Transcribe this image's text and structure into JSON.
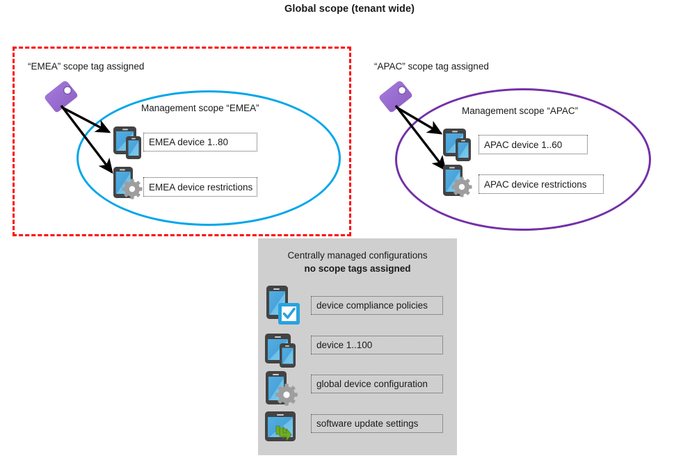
{
  "diagram": {
    "title": "Global scope (tenant wide)",
    "colors": {
      "scope_box_border": "#fe0000",
      "emea_ellipse": "#00a6eb",
      "apac_ellipse": "#7430a8",
      "tag_icon": "#9b6fd4",
      "panel_background": "#cfcfcf",
      "device_screen": "#4aa3db",
      "device_body": "#434343",
      "gear": "#9e9e9e",
      "check_badge": "#29a3dd",
      "sync_arrow": "#6fae24"
    }
  },
  "emea": {
    "scope_tag_label": "“EMEA” scope tag assigned",
    "management_scope_label": "Management scope “EMEA”",
    "tag_icon": "tag-icon",
    "items": [
      {
        "icon": "devices-icon",
        "label": "EMEA device 1..80"
      },
      {
        "icon": "device-settings-icon",
        "label": "EMEA device restrictions"
      }
    ]
  },
  "apac": {
    "scope_tag_label": "“APAC” scope tag assigned",
    "management_scope_label": "Management scope “APAC”",
    "tag_icon": "tag-icon",
    "items": [
      {
        "icon": "devices-icon",
        "label": "APAC device 1..60"
      },
      {
        "icon": "device-settings-icon",
        "label": "APAC device restrictions"
      }
    ]
  },
  "central": {
    "title_line1": "Centrally managed configurations",
    "title_line2": "no scope tags assigned",
    "items": [
      {
        "icon": "device-compliance-icon",
        "label": "device compliance policies"
      },
      {
        "icon": "devices-icon",
        "label": "device 1..100"
      },
      {
        "icon": "device-settings-icon",
        "label": "global device configuration"
      },
      {
        "icon": "device-sync-icon",
        "label": "software update settings"
      }
    ]
  }
}
